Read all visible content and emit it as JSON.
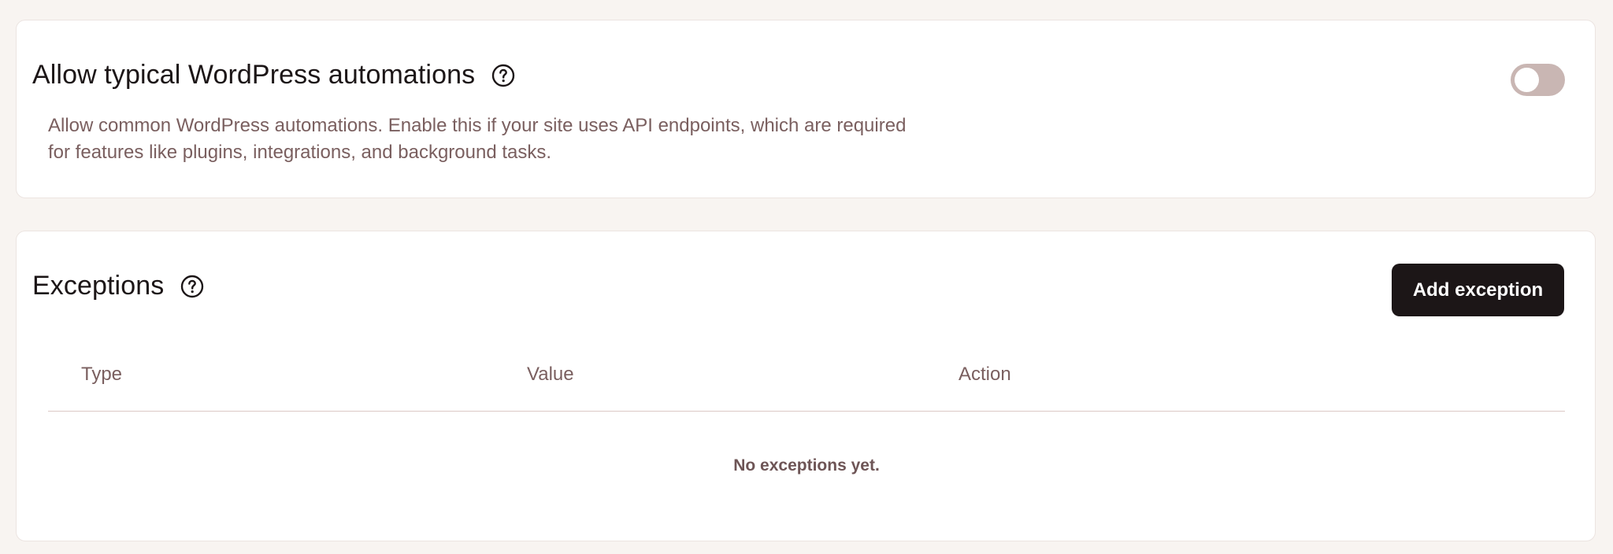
{
  "automations": {
    "title": "Allow typical WordPress automations",
    "help_icon": "question-circle-icon",
    "description": "Allow common WordPress automations. Enable this if your site uses API endpoints, which are required for features like plugins, integrations, and background tasks.",
    "toggle": {
      "enabled": false,
      "off_color": "#c9b6b3"
    }
  },
  "exceptions": {
    "title": "Exceptions",
    "help_icon": "question-circle-icon",
    "add_button_label": "Add exception",
    "columns": [
      "Type",
      "Value",
      "Action"
    ],
    "rows": [],
    "empty_message": "No exceptions yet."
  },
  "colors": {
    "background": "#f8f4f1",
    "card": "#ffffff",
    "primary_button": "#1c1617",
    "muted_text": "#7a5f5f"
  }
}
